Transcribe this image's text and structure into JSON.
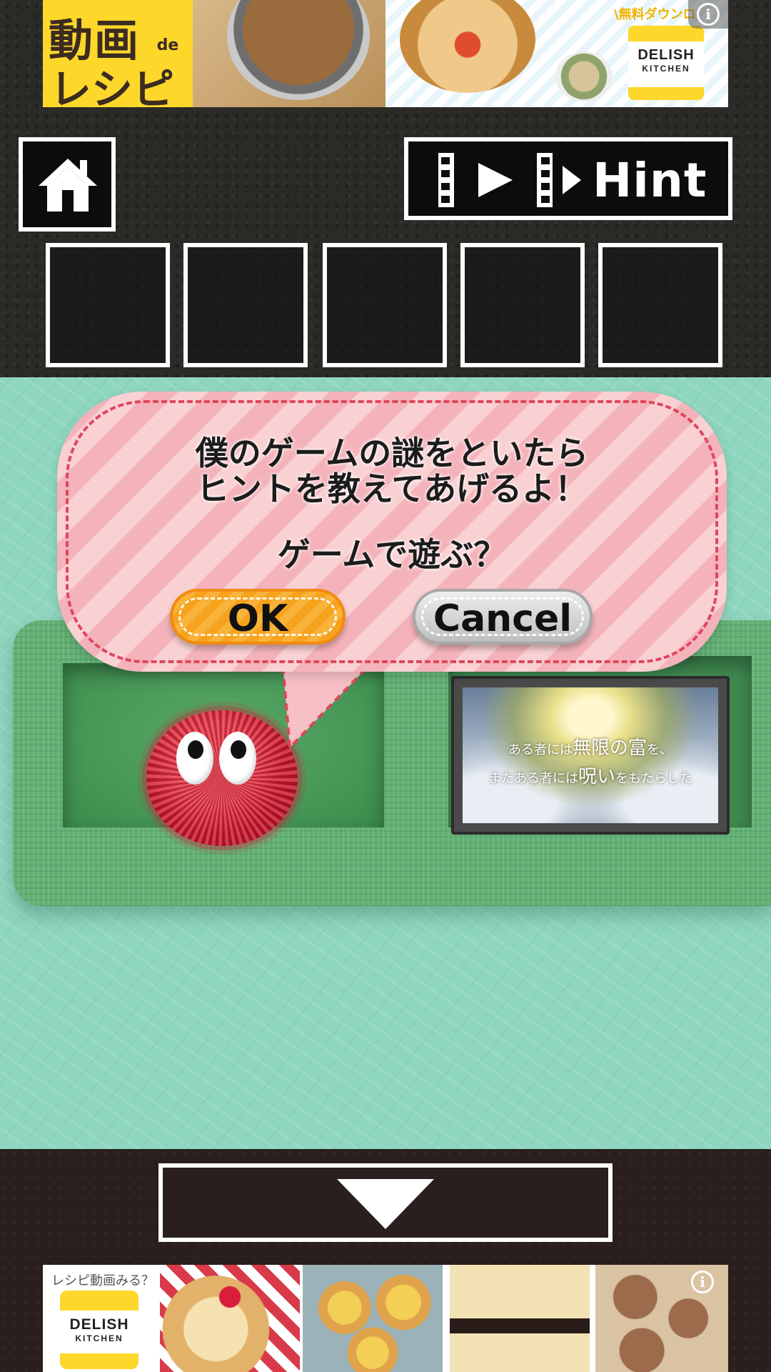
{
  "ads": {
    "top": {
      "headline_line1": "動画",
      "headline_de": "de",
      "headline_line2": "レシピ",
      "promo": "\\無料ダウンロ",
      "brand_line1": "DELISH",
      "brand_line2": "KITCHEN",
      "info_icon": "info-icon"
    },
    "bottom": {
      "prompt": "レシピ動画みる？",
      "brand_line1": "DELISH",
      "brand_line2": "KITCHEN",
      "info_icon": "info-icon"
    }
  },
  "toolbar": {
    "home_icon": "home-icon",
    "hint_icon": "video-play-icon",
    "hint_label": "Hint"
  },
  "inventory": {
    "slots": [
      "",
      "",
      "",
      "",
      ""
    ]
  },
  "dialog": {
    "line1": "僕のゲームの謎をといたら",
    "line2": "ヒントを教えてあげるよ！",
    "question": "ゲームで遊ぶ？",
    "ok_label": "OK",
    "cancel_label": "Cancel"
  },
  "monitor": {
    "caption1_a": "ある者には",
    "caption1_b": "無限の富",
    "caption1_c": "を、",
    "caption2_a": "またある者には",
    "caption2_b": "呪い",
    "caption2_c": "をもたらした"
  },
  "navigation": {
    "down_icon": "down-arrow-icon"
  },
  "colors": {
    "scene_bg": "#8fd6bf",
    "grass": "#62b074",
    "bubble_pink": "#f4b3ba",
    "ok_orange": "#f7a21d",
    "cancel_gray": "#bdbdbd",
    "creature_red": "#c51f33",
    "brand_yellow": "#fed72b"
  }
}
